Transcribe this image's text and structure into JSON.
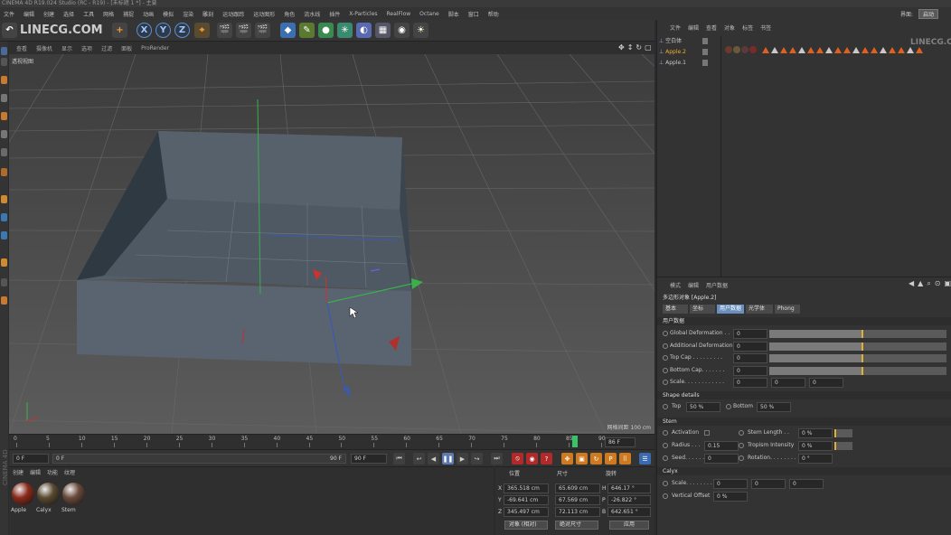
{
  "app": {
    "title": "CINEMA 4D R19.024 Studio (RC - R19) - [未标题 1 *] - 主要",
    "layout_label": "界面:",
    "layout_value": "启动"
  },
  "menubar": [
    "文件",
    "编辑",
    "创建",
    "选择",
    "工具",
    "网格",
    "捕捉",
    "动画",
    "模拟",
    "渲染",
    "雕刻",
    "运动跟踪",
    "运动图形",
    "角色",
    "流水线",
    "插件",
    "X-Particles",
    "RealFlow",
    "Octane",
    "脚本",
    "窗口",
    "帮助"
  ],
  "watermark": {
    "text": "LINECG.COM",
    "side_text": "CINEMA 4D"
  },
  "viewport": {
    "menu": [
      "查看",
      "摄像机",
      "显示",
      "选项",
      "过滤",
      "面板",
      "ProRender"
    ],
    "label": "透视视图",
    "grid_info_label": "网格间距",
    "grid_info_value": "100 cm"
  },
  "timeline": {
    "ticks": [
      "0",
      "5",
      "10",
      "15",
      "20",
      "25",
      "30",
      "35",
      "40",
      "45",
      "50",
      "55",
      "60",
      "65",
      "70",
      "75",
      "80",
      "85",
      "90"
    ],
    "current_frame_display": "86 F",
    "playhead_frame": 86
  },
  "transport": {
    "start_field": "0 F",
    "range_start": "0 F",
    "range_end": "90 F",
    "end_field": "90 F"
  },
  "materials": {
    "menu": [
      "创建",
      "编辑",
      "功能",
      "纹理"
    ],
    "items": [
      {
        "name": "Apple",
        "color": "#8a2a1a"
      },
      {
        "name": "Calyx",
        "color": "#5a4a30"
      },
      {
        "name": "Stem",
        "color": "#6a4a3a"
      }
    ]
  },
  "coords": {
    "headers": [
      "位置",
      "尺寸",
      "旋转"
    ],
    "rows": [
      {
        "axis": "X",
        "pos": "365.518 cm",
        "size": "65.609 cm",
        "rot_axis": "H",
        "rot": "646.17 °"
      },
      {
        "axis": "Y",
        "pos": "-69.641 cm",
        "size": "67.569 cm",
        "rot_axis": "P",
        "rot": "-26.822 °"
      },
      {
        "axis": "Z",
        "pos": "345.497 cm",
        "size": "72.113 cm",
        "rot_axis": "B",
        "rot": "642.651 °"
      }
    ],
    "mode1": "对象 (相对)",
    "mode2": "绝对尺寸",
    "apply": "应用"
  },
  "object_manager": {
    "menu": [
      "文件",
      "编辑",
      "查看",
      "对象",
      "标签",
      "书签"
    ],
    "objects": [
      {
        "name": "空白体",
        "color": "#c8c8c8"
      },
      {
        "name": "Apple.2",
        "color": "#f0b030"
      },
      {
        "name": "Apple.1",
        "color": "#c8c8c8"
      }
    ]
  },
  "attributes": {
    "menu": [
      "模式",
      "编辑",
      "用户数据"
    ],
    "object_title": "多边形对象 [Apple.2]",
    "tabs": [
      "基本",
      "坐标",
      "用户数据",
      "光学体",
      "Phong"
    ],
    "active_tab": 2,
    "section_user": "用户数据",
    "user_params": [
      {
        "label": "Global Deformation . .",
        "value": "0",
        "fill": 0.52
      },
      {
        "label": "Additional Deformation",
        "value": "0",
        "fill": 0.52
      },
      {
        "label": "Top Cap . . . . . . . . .",
        "value": "0",
        "fill": 0.52
      },
      {
        "label": "Bottom Cap. . . . . . .",
        "value": "0",
        "fill": 0.52
      }
    ],
    "scale": {
      "label": "Scale. . . . . . . . . . . .",
      "v1": "0",
      "v2": "0",
      "v3": "0"
    },
    "shape_details": {
      "title": "Shape details",
      "top_label": "Top",
      "top_value": "50 %",
      "bottom_label": "Bottom",
      "bottom_value": "50 %"
    },
    "stem": {
      "title": "Stem",
      "activation": "Activation",
      "stem_length_label": "Stem Length . .",
      "stem_length_value": "0 %",
      "radius_label": "Radius . . .",
      "radius_value": "0.15",
      "tropism_label": "Tropism Intensity",
      "tropism_value": "0 %",
      "seed_label": "Seed. . . . . .",
      "seed_value": "0",
      "rotation_label": "Rotation. . . . . . . .",
      "rotation_value": "0 °"
    },
    "calyx": {
      "title": "Calyx",
      "scale_label": "Scale. . . . . . . . . . . .",
      "v1": "0",
      "v2": "0",
      "v3": "0",
      "vertical_offset_label": "Vertical Offset",
      "vertical_offset_value": "0 %"
    }
  }
}
